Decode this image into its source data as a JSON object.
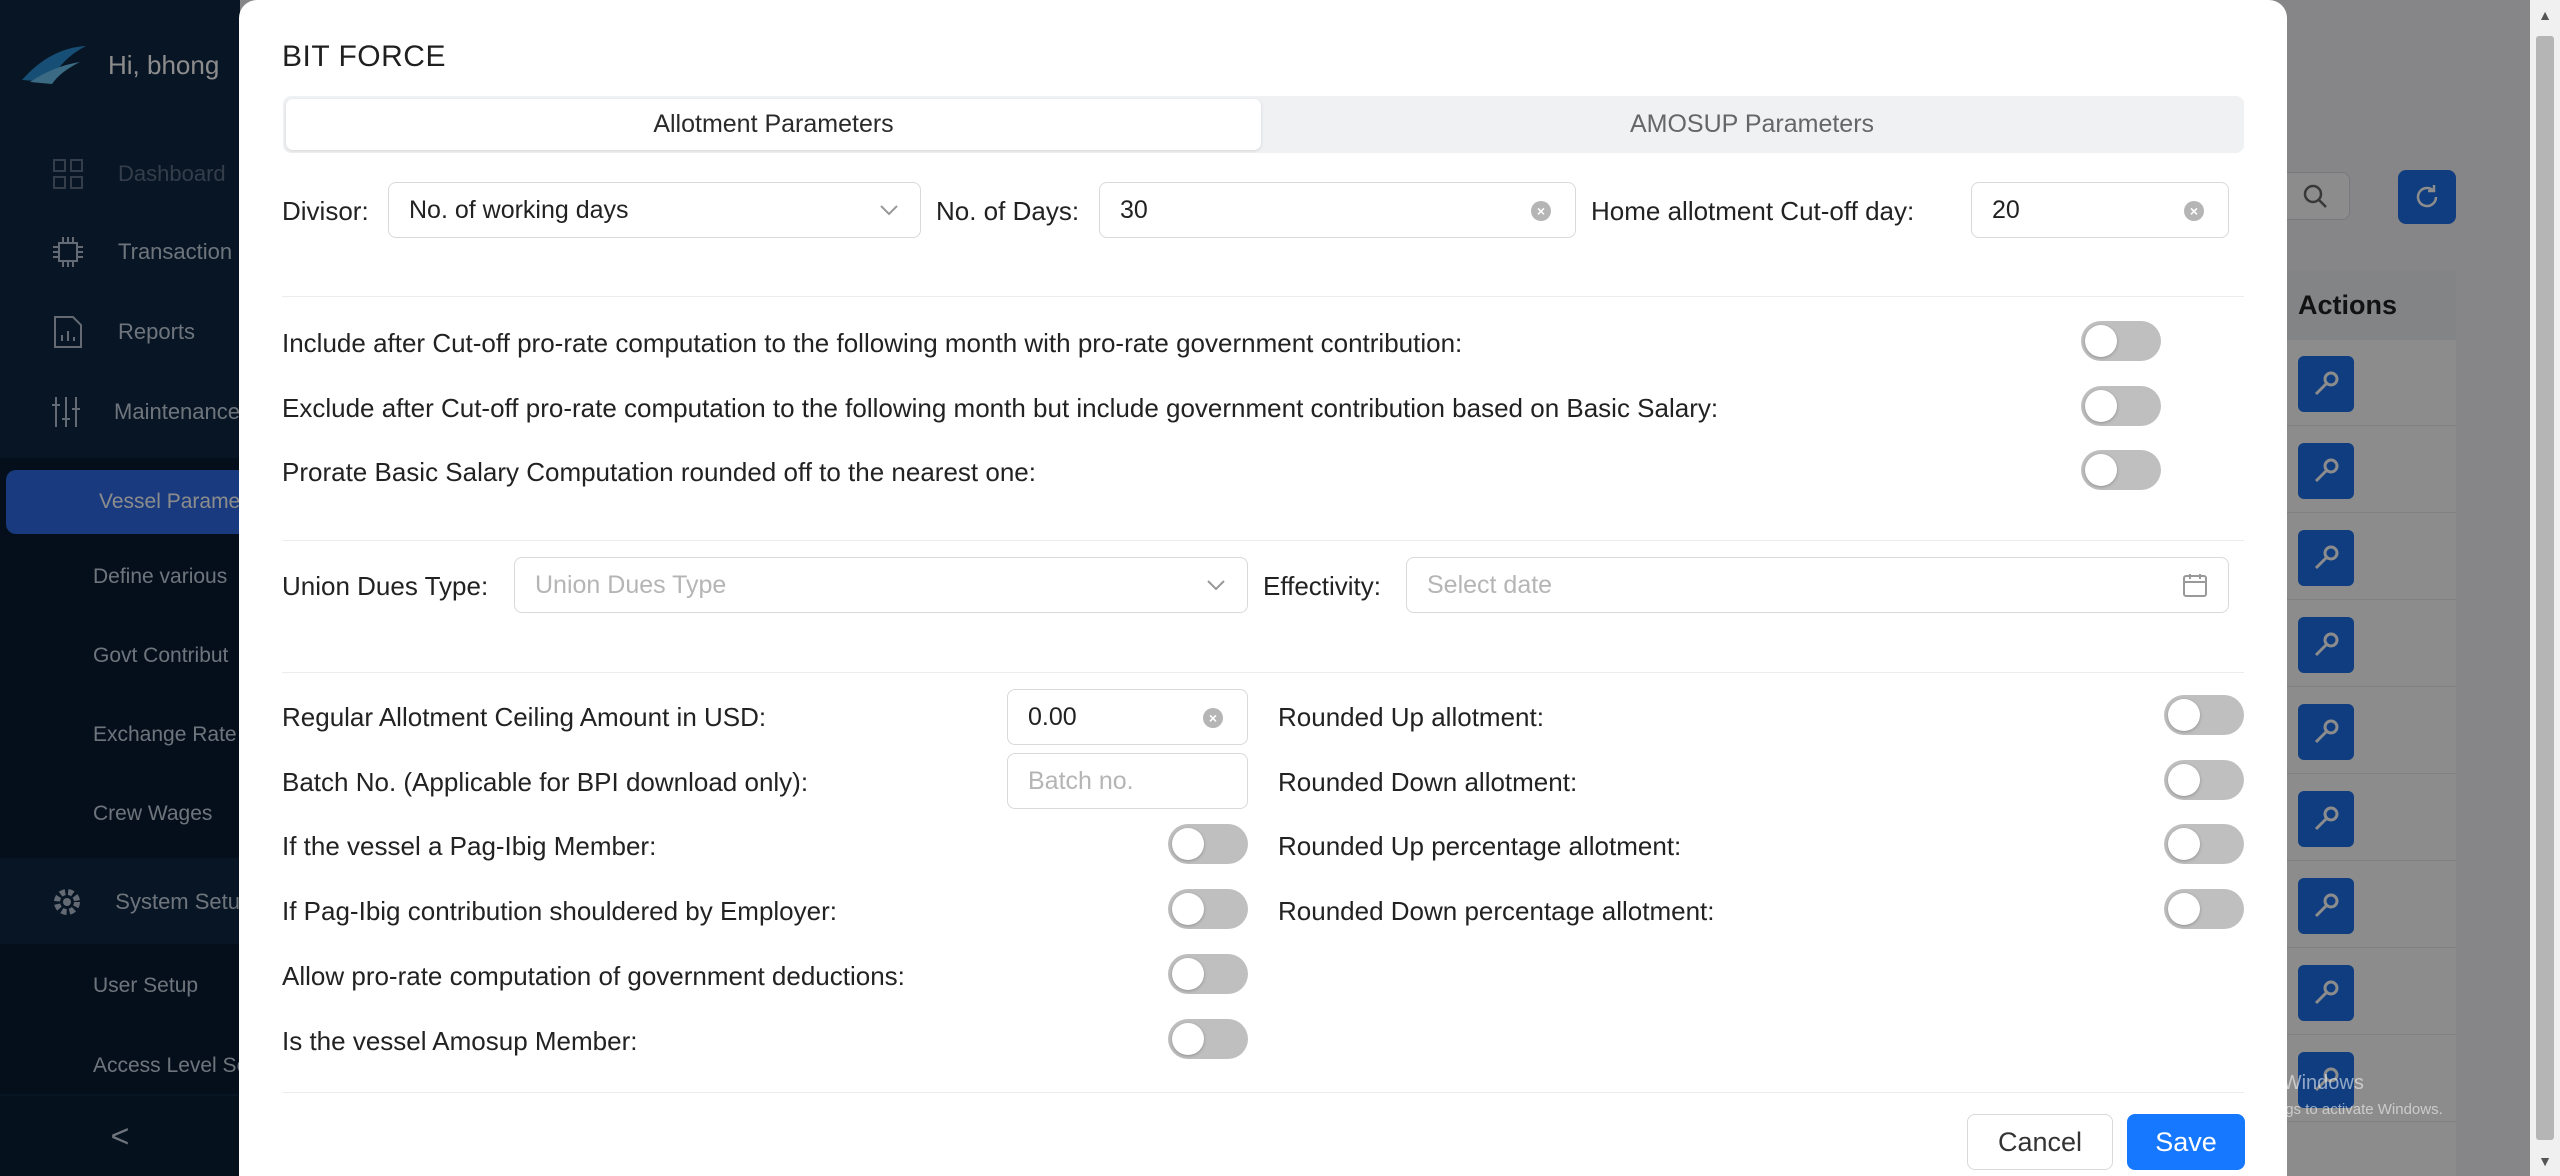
{
  "app": {
    "greeting": "Hi, bhong",
    "nav": {
      "dashboard": "Dashboard",
      "transaction": "Transaction",
      "reports": "Reports",
      "maintenance": "Maintenance",
      "vessel_params": "Vessel Parame",
      "define_various": "Define various",
      "govt_contrib": "Govt Contribut",
      "exchange_rate": "Exchange Rate",
      "crew_wages": "Crew Wages",
      "system_setup": "System Setu",
      "user_setup": "User Setup",
      "access_level": "Access Level Se"
    },
    "table_actions_header": "Actions",
    "collapse_glyph": "<"
  },
  "modal": {
    "title": "BIT FORCE",
    "tabs": [
      "Allotment Parameters",
      "AMOSUP Parameters"
    ],
    "divisor": {
      "label": "Divisor",
      "value": "No. of working days"
    },
    "no_of_days": {
      "label": "No. of Days",
      "value": "30"
    },
    "cutoff_day": {
      "label": "Home allotment Cut-off day",
      "value": "20"
    },
    "computation_toggles": [
      {
        "label": "Include after Cut-off pro-rate computation to the following month with pro-rate government contribution",
        "on": false
      },
      {
        "label": "Exclude after Cut-off pro-rate computation to the following month but include government contribution based on Basic Salary",
        "on": false
      },
      {
        "label": "Prorate Basic Salary Computation rounded off to the nearest one",
        "on": false
      }
    ],
    "union_dues": {
      "label": "Union Dues Type",
      "placeholder": "Union Dues Type"
    },
    "effectivity": {
      "label": "Effectivity",
      "placeholder": "Select date"
    },
    "ceiling": {
      "label": "Regular Allotment Ceiling Amount in USD",
      "value": "0.00"
    },
    "batch": {
      "label": "Batch No. (Applicable for BPI download only)",
      "placeholder": "Batch no."
    },
    "left_toggles": [
      {
        "label": "If the vessel a Pag-Ibig Member",
        "on": false
      },
      {
        "label": "If Pag-Ibig contribution shouldered by Employer",
        "on": false
      },
      {
        "label": "Allow pro-rate computation of government deductions",
        "on": false
      },
      {
        "label": "Is the vessel Amosup Member",
        "on": false
      }
    ],
    "right_toggles": [
      {
        "label": "Rounded Up allotment",
        "on": false
      },
      {
        "label": "Rounded Down allotment",
        "on": false
      },
      {
        "label": "Rounded Up percentage allotment",
        "on": false
      },
      {
        "label": "Rounded Down percentage allotment",
        "on": false
      }
    ],
    "cancel_label": "Cancel",
    "save_label": "Save"
  },
  "watermark": {
    "line1": "Activate Windows",
    "line2": "Go to Settings to activate Windows."
  },
  "colors": {
    "sidebar_bg": "#0f2742",
    "accent": "#1677ff",
    "active_nav": "#2e6be6",
    "toggle_off": "#bfbfbf"
  }
}
